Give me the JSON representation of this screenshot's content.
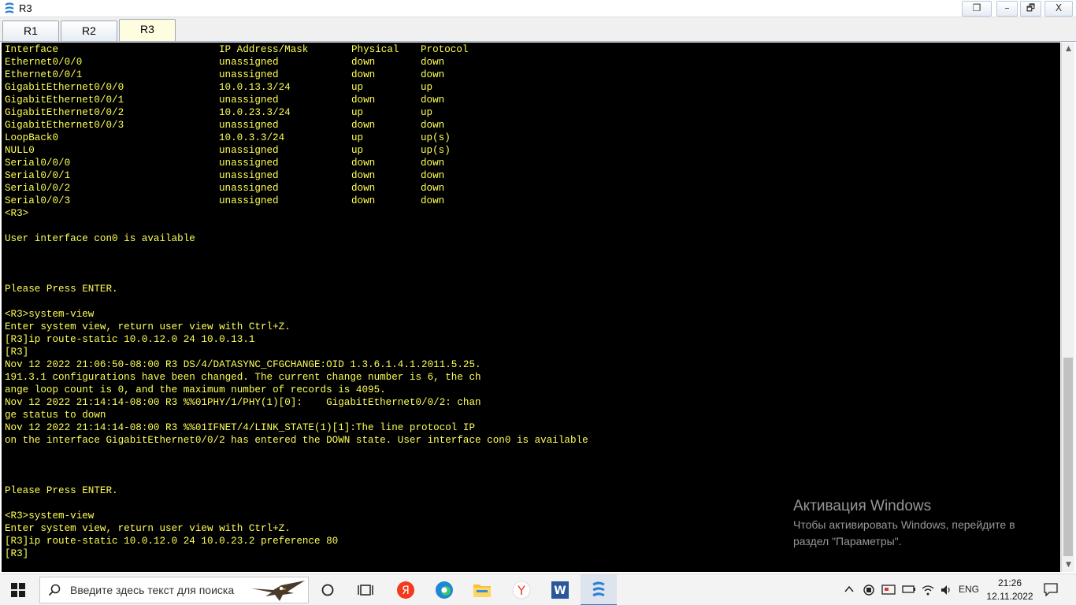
{
  "window": {
    "title": "R3",
    "buttons": {
      "restore_alt": "❐",
      "minimize": "–",
      "maximize": "🗗",
      "close": "X"
    }
  },
  "tabs": [
    {
      "label": "R1"
    },
    {
      "label": "R2"
    },
    {
      "label": "R3",
      "active": true
    }
  ],
  "terminal": {
    "table_header": [
      "Interface",
      "IP Address/Mask",
      "Physical",
      "Protocol"
    ],
    "interfaces": [
      [
        "Ethernet0/0/0",
        "unassigned",
        "down",
        "down"
      ],
      [
        "Ethernet0/0/1",
        "unassigned",
        "down",
        "down"
      ],
      [
        "GigabitEthernet0/0/0",
        "10.0.13.3/24",
        "up",
        "up"
      ],
      [
        "GigabitEthernet0/0/1",
        "unassigned",
        "down",
        "down"
      ],
      [
        "GigabitEthernet0/0/2",
        "10.0.23.3/24",
        "up",
        "up"
      ],
      [
        "GigabitEthernet0/0/3",
        "unassigned",
        "down",
        "down"
      ],
      [
        "LoopBack0",
        "10.0.3.3/24",
        "up",
        "up(s)"
      ],
      [
        "NULL0",
        "unassigned",
        "up",
        "up(s)"
      ],
      [
        "Serial0/0/0",
        "unassigned",
        "down",
        "down"
      ],
      [
        "Serial0/0/1",
        "unassigned",
        "down",
        "down"
      ],
      [
        "Serial0/0/2",
        "unassigned",
        "down",
        "down"
      ],
      [
        "Serial0/0/3",
        "unassigned",
        "down",
        "down"
      ]
    ],
    "lines": [
      "<R3>",
      "",
      "User interface con0 is available",
      "",
      "",
      "",
      "Please Press ENTER.",
      "",
      "<R3>system-view",
      "Enter system view, return user view with Ctrl+Z.",
      "[R3]ip route-static 10.0.12.0 24 10.0.13.1",
      "[R3]",
      "Nov 12 2022 21:06:50-08:00 R3 DS/4/DATASYNC_CFGCHANGE:OID 1.3.6.1.4.1.2011.5.25.",
      "191.3.1 configurations have been changed. The current change number is 6, the ch",
      "ange loop count is 0, and the maximum number of records is 4095.",
      "Nov 12 2022 21:14:14-08:00 R3 %%01PHY/1/PHY(1)[0]:    GigabitEthernet0/0/2: chan",
      "ge status to down",
      "Nov 12 2022 21:14:14-08:00 R3 %%01IFNET/4/LINK_STATE(1)[1]:The line protocol IP",
      "on the interface GigabitEthernet0/0/2 has entered the DOWN state. User interface con0 is available",
      "",
      "",
      "",
      "Please Press ENTER.",
      "",
      "<R3>system-view",
      "Enter system view, return user view with Ctrl+Z.",
      "[R3]ip route-static 10.0.12.0 24 10.0.23.2 preference 80",
      "[R3]"
    ]
  },
  "watermark": {
    "title": "Активация Windows",
    "line1": "Чтобы активировать Windows, перейдите в",
    "line2": "раздел \"Параметры\"."
  },
  "taskbar": {
    "search_placeholder": "Введите здесь текст для поиска",
    "tray_lang": "ENG",
    "time": "21:26",
    "date": "12.11.2022"
  },
  "colors": {
    "terminal_bg": "#000000",
    "terminal_text": "#ffff55",
    "active_tab": "#fffde0"
  }
}
